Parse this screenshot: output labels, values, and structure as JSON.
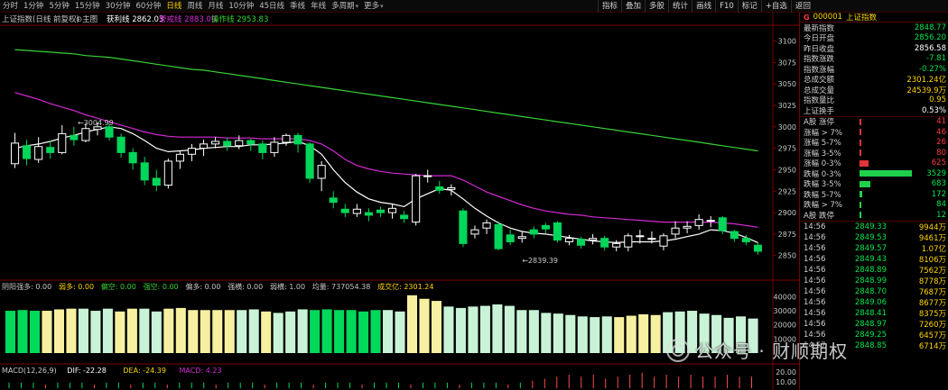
{
  "toolbar": {
    "tabs": [
      "分时",
      "1分钟",
      "5分钟",
      "15分钟",
      "30分钟",
      "60分钟",
      "日线",
      "周线",
      "月线",
      "10分钟",
      "45日线",
      "季线",
      "年线",
      "多周期",
      "更多"
    ],
    "active_tab": "日线",
    "tools": [
      "指标",
      "叠加",
      "多股",
      "统计",
      "画线",
      "F10",
      "标记",
      "+自选",
      "返回"
    ]
  },
  "main": {
    "title": "上证指数",
    "subtitle": "(日线 前复权)",
    "indicator": "主图",
    "legend": [
      {
        "label": "获利线",
        "value": "2862.03",
        "color": "#ffffff"
      },
      {
        "label": "警戒线",
        "value": "2883.09",
        "color": "#d22ad2"
      },
      {
        "label": "操作线",
        "value": "2953.83",
        "color": "#36d436"
      }
    ],
    "annotations": {
      "high": "3004.99",
      "low": "2839.39"
    },
    "axis_ticks": [
      "3100",
      "3075",
      "3050",
      "3025",
      "3000",
      "2975",
      "2950",
      "2925",
      "2900",
      "2875",
      "2850"
    ]
  },
  "volume": {
    "legend": [
      {
        "label": "阴阳",
        "value": "",
        "color": "#c8c8c8"
      },
      {
        "label": "强多",
        "value": "0.00",
        "color": "#c8c8c8"
      },
      {
        "label": "弱多",
        "value": "0.00",
        "color": "#ffd400"
      },
      {
        "label": "偏空",
        "value": "0.00",
        "color": "#36d436"
      },
      {
        "label": "强空",
        "value": "0.00",
        "color": "#36d436"
      },
      {
        "label": "偏多",
        "value": "0.00",
        "color": "#c8c8c8"
      },
      {
        "label": "强横",
        "value": "0.00",
        "color": "#c8c8c8"
      },
      {
        "label": "弱横",
        "value": "1.00",
        "color": "#c8c8c8"
      },
      {
        "label": "均量",
        "value": "737054.38",
        "color": "#c8c8c8"
      },
      {
        "label": "成交亿",
        "value": "2301.24",
        "color": "#ffd400"
      }
    ],
    "axis_ticks": [
      "40000",
      "30000",
      "20000",
      "10000"
    ]
  },
  "macd": {
    "legend": [
      {
        "label": "MACD(12,26,9)",
        "value": "",
        "color": "#c8c8c8"
      },
      {
        "label": "DIF",
        "value": "-22.28",
        "color": "#ffffff"
      },
      {
        "label": "DEA",
        "value": "-24.39",
        "color": "#ffd400"
      },
      {
        "label": "MACD",
        "value": "4.23",
        "color": "#d22ad2"
      }
    ],
    "axis_ticks": [
      "20.00",
      "10.00"
    ]
  },
  "chart_data": {
    "type": "candlestick",
    "ylim": [
      2835,
      3110
    ],
    "y_ticks": [
      3100,
      3075,
      3050,
      3025,
      3000,
      2975,
      2950,
      2925,
      2900,
      2875,
      2850
    ],
    "candles": [
      {
        "o": 2957,
        "c": 2981,
        "h": 2993,
        "l": 2952,
        "up": true
      },
      {
        "o": 2978,
        "c": 2963,
        "h": 2985,
        "l": 2955,
        "up": false
      },
      {
        "o": 2962,
        "c": 2977,
        "h": 2988,
        "l": 2958,
        "up": true
      },
      {
        "o": 2976,
        "c": 2970,
        "h": 2984,
        "l": 2963,
        "up": false
      },
      {
        "o": 2970,
        "c": 2992,
        "h": 3002,
        "l": 2968,
        "up": true
      },
      {
        "o": 2990,
        "c": 2985,
        "h": 3000,
        "l": 2978,
        "up": false
      },
      {
        "o": 2984,
        "c": 2998,
        "h": 3004,
        "l": 2982,
        "up": true
      },
      {
        "o": 2997,
        "c": 3000,
        "h": 3005,
        "l": 2990,
        "up": true
      },
      {
        "o": 3000,
        "c": 2988,
        "h": 3004,
        "l": 2984,
        "up": false
      },
      {
        "o": 2988,
        "c": 2970,
        "h": 2992,
        "l": 2964,
        "up": false
      },
      {
        "o": 2970,
        "c": 2958,
        "h": 2975,
        "l": 2950,
        "up": false
      },
      {
        "o": 2958,
        "c": 2938,
        "h": 2965,
        "l": 2932,
        "up": false
      },
      {
        "o": 2940,
        "c": 2932,
        "h": 2950,
        "l": 2925,
        "up": false
      },
      {
        "o": 2932,
        "c": 2960,
        "h": 2963,
        "l": 2928,
        "up": true
      },
      {
        "o": 2960,
        "c": 2968,
        "h": 2972,
        "l": 2951,
        "up": true
      },
      {
        "o": 2968,
        "c": 2975,
        "h": 2980,
        "l": 2960,
        "up": true
      },
      {
        "o": 2975,
        "c": 2980,
        "h": 2985,
        "l": 2966,
        "up": true
      },
      {
        "o": 2980,
        "c": 2983,
        "h": 2988,
        "l": 2975,
        "up": true
      },
      {
        "o": 2983,
        "c": 2978,
        "h": 2987,
        "l": 2972,
        "up": false
      },
      {
        "o": 2978,
        "c": 2984,
        "h": 2990,
        "l": 2974,
        "up": true
      },
      {
        "o": 2984,
        "c": 2980,
        "h": 2986,
        "l": 2972,
        "up": false
      },
      {
        "o": 2980,
        "c": 2970,
        "h": 2984,
        "l": 2962,
        "up": false
      },
      {
        "o": 2970,
        "c": 2982,
        "h": 2988,
        "l": 2965,
        "up": true
      },
      {
        "o": 2982,
        "c": 2990,
        "h": 2992,
        "l": 2978,
        "up": true
      },
      {
        "o": 2990,
        "c": 2980,
        "h": 2993,
        "l": 2970,
        "up": false
      },
      {
        "o": 2980,
        "c": 2940,
        "h": 2982,
        "l": 2935,
        "up": false
      },
      {
        "o": 2940,
        "c": 2955,
        "h": 2960,
        "l": 2925,
        "up": true
      },
      {
        "o": 2917,
        "c": 2912,
        "h": 2925,
        "l": 2905,
        "up": false
      },
      {
        "o": 2904,
        "c": 2900,
        "h": 2910,
        "l": 2895,
        "up": false
      },
      {
        "o": 2899,
        "c": 2904,
        "h": 2910,
        "l": 2895,
        "up": true
      },
      {
        "o": 2900,
        "c": 2897,
        "h": 2905,
        "l": 2890,
        "up": false
      },
      {
        "o": 2903,
        "c": 2900,
        "h": 2907,
        "l": 2895,
        "up": false
      },
      {
        "o": 2900,
        "c": 2905,
        "h": 2910,
        "l": 2893,
        "up": true
      },
      {
        "o": 2897,
        "c": 2893,
        "h": 2902,
        "l": 2888,
        "up": false
      },
      {
        "o": 2889,
        "c": 2943,
        "h": 2945,
        "l": 2885,
        "up": true
      },
      {
        "o": 2943,
        "c": 2943,
        "h": 2950,
        "l": 2935,
        "up": true
      },
      {
        "o": 2930,
        "c": 2926,
        "h": 2937,
        "l": 2922,
        "up": false
      },
      {
        "o": 2927,
        "c": 2929,
        "h": 2933,
        "l": 2920,
        "up": true
      },
      {
        "o": 2902,
        "c": 2864,
        "h": 2905,
        "l": 2860,
        "up": false
      },
      {
        "o": 2875,
        "c": 2880,
        "h": 2885,
        "l": 2870,
        "up": true
      },
      {
        "o": 2882,
        "c": 2888,
        "h": 2892,
        "l": 2875,
        "up": true
      },
      {
        "o": 2886,
        "c": 2858,
        "h": 2890,
        "l": 2856,
        "up": false
      },
      {
        "o": 2874,
        "c": 2866,
        "h": 2880,
        "l": 2862,
        "up": false
      },
      {
        "o": 2870,
        "c": 2872,
        "h": 2878,
        "l": 2865,
        "up": true
      },
      {
        "o": 2880,
        "c": 2875,
        "h": 2884,
        "l": 2870,
        "up": false
      },
      {
        "o": 2885,
        "c": 2881,
        "h": 2888,
        "l": 2876,
        "up": false
      },
      {
        "o": 2888,
        "c": 2868,
        "h": 2890,
        "l": 2865,
        "up": false
      },
      {
        "o": 2866,
        "c": 2870,
        "h": 2874,
        "l": 2862,
        "up": true
      },
      {
        "o": 2869,
        "c": 2862,
        "h": 2872,
        "l": 2858,
        "up": false
      },
      {
        "o": 2868,
        "c": 2870,
        "h": 2875,
        "l": 2863,
        "up": true
      },
      {
        "o": 2870,
        "c": 2860,
        "h": 2873,
        "l": 2856,
        "up": false
      },
      {
        "o": 2860,
        "c": 2864,
        "h": 2868,
        "l": 2855,
        "up": true
      },
      {
        "o": 2860,
        "c": 2873,
        "h": 2876,
        "l": 2855,
        "up": true
      },
      {
        "o": 2873,
        "c": 2873,
        "h": 2880,
        "l": 2864,
        "up": true
      },
      {
        "o": 2870,
        "c": 2870,
        "h": 2878,
        "l": 2864,
        "up": true
      },
      {
        "o": 2861,
        "c": 2873,
        "h": 2876,
        "l": 2856,
        "up": true
      },
      {
        "o": 2875,
        "c": 2882,
        "h": 2890,
        "l": 2870,
        "up": true
      },
      {
        "o": 2882,
        "c": 2884,
        "h": 2890,
        "l": 2876,
        "up": true
      },
      {
        "o": 2885,
        "c": 2892,
        "h": 2898,
        "l": 2880,
        "up": true
      },
      {
        "o": 2890,
        "c": 2891,
        "h": 2896,
        "l": 2883,
        "up": true
      },
      {
        "o": 2894,
        "c": 2879,
        "h": 2896,
        "l": 2875,
        "up": false
      },
      {
        "o": 2878,
        "c": 2870,
        "h": 2880,
        "l": 2866,
        "up": false
      },
      {
        "o": 2870,
        "c": 2866,
        "h": 2874,
        "l": 2862,
        "up": false
      },
      {
        "o": 2862,
        "c": 2855,
        "h": 2866,
        "l": 2851,
        "up": false
      }
    ],
    "series": [
      {
        "name": "获利线",
        "color": "#ffffff",
        "values": [
          2975,
          2978,
          2980,
          2983,
          2987,
          2990,
          2994,
          2997,
          3000,
          2998,
          2992,
          2984,
          2975,
          2971,
          2972,
          2973,
          2975,
          2976,
          2977,
          2977,
          2979,
          2979,
          2980,
          2981,
          2983,
          2978,
          2968,
          2950,
          2935,
          2924,
          2916,
          2912,
          2910,
          2907,
          2916,
          2922,
          2928,
          2926,
          2916,
          2905,
          2896,
          2888,
          2882,
          2878,
          2876,
          2875,
          2873,
          2871,
          2869,
          2867,
          2866,
          2865,
          2866,
          2866,
          2866,
          2867,
          2869,
          2872,
          2875,
          2880,
          2879,
          2876,
          2871,
          2865
        ]
      },
      {
        "name": "警戒线",
        "color": "#d22ad2",
        "values": [
          3040,
          3036,
          3032,
          3027,
          3023,
          3019,
          3014,
          3010,
          3006,
          3002,
          2998,
          2994,
          2991,
          2989,
          2988,
          2988,
          2988,
          2988,
          2987,
          2987,
          2987,
          2986,
          2986,
          2986,
          2986,
          2984,
          2980,
          2972,
          2962,
          2955,
          2951,
          2948,
          2946,
          2945,
          2944,
          2943,
          2943,
          2943,
          2938,
          2931,
          2924,
          2919,
          2914,
          2909,
          2905,
          2902,
          2900,
          2898,
          2897,
          2895,
          2894,
          2893,
          2892,
          2891,
          2890,
          2889,
          2889,
          2889,
          2889,
          2889,
          2888,
          2887,
          2885,
          2883
        ]
      },
      {
        "name": "操作线",
        "color": "#36d436",
        "values": [
          3090,
          3089,
          3088,
          3087,
          3086,
          3085,
          3083,
          3082,
          3081,
          3079,
          3077,
          3075,
          3073,
          3071,
          3069,
          3067,
          3066,
          3064,
          3062,
          3060,
          3058,
          3056,
          3054,
          3052,
          3050,
          3048,
          3046,
          3044,
          3042,
          3040,
          3038,
          3036,
          3034,
          3032,
          3030,
          3028,
          3026,
          3024,
          3022,
          3020,
          3018,
          3016,
          3014,
          3012,
          3010,
          3008,
          3006,
          3004,
          3002,
          3000,
          2998,
          2996,
          2994,
          2992,
          2990,
          2988,
          2986,
          2984,
          2982,
          2980,
          2978,
          2976,
          2974,
          2972
        ]
      }
    ],
    "volume": {
      "ylim": [
        0,
        46000
      ],
      "values": [
        30000,
        30500,
        30000,
        30000,
        31000,
        31500,
        31500,
        30000,
        31500,
        29500,
        31500,
        31500,
        29500,
        31500,
        32000,
        30500,
        30500,
        30500,
        30500,
        30500,
        31000,
        29500,
        28500,
        29500,
        31000,
        30500,
        31000,
        30500,
        30500,
        29500,
        30500,
        30500,
        29500,
        41000,
        38500,
        37000,
        33000,
        32000,
        33000,
        33500,
        34500,
        33500,
        30500,
        30500,
        28500,
        28000,
        27000,
        26000,
        25500,
        26000,
        25500,
        26500,
        27500,
        27000,
        29000,
        29500,
        30000,
        28000,
        27000,
        25000,
        26000,
        24500
      ],
      "colors": [
        "g",
        "g",
        "g",
        "y",
        "y",
        "y",
        "l",
        "l",
        "l",
        "y",
        "y",
        "l",
        "l",
        "y",
        "y",
        "y",
        "y",
        "y",
        "y",
        "l",
        "l",
        "y",
        "l",
        "l",
        "l",
        "g",
        "g",
        "g",
        "g",
        "g",
        "g",
        "l",
        "l",
        "y",
        "y",
        "y",
        "l",
        "l",
        "l",
        "l",
        "l",
        "l",
        "l",
        "l",
        "l",
        "l",
        "l",
        "l",
        "l",
        "l",
        "y",
        "y",
        "y",
        "y",
        "l",
        "l",
        "l",
        "l",
        "l",
        "l",
        "l",
        "l"
      ]
    },
    "macd": {
      "ylim": [
        -30,
        25
      ],
      "y_ticks": [
        20,
        10
      ],
      "values": [
        -1,
        -1,
        -1,
        0,
        -1,
        -1,
        -1,
        0,
        -1,
        -1,
        0,
        -1,
        -1,
        0,
        -1,
        -1,
        -1,
        0,
        -1,
        -1,
        -1,
        0,
        -1,
        -1,
        -1,
        0,
        -1,
        -1,
        -1,
        0,
        -1,
        -1,
        -1,
        0,
        -1,
        -1,
        -1,
        0,
        -1,
        -1,
        -1,
        0,
        -1,
        2,
        3,
        4,
        5,
        4,
        5,
        3,
        4,
        5,
        6,
        4,
        5,
        4,
        5,
        4,
        4,
        5,
        4,
        4
      ]
    }
  },
  "side": {
    "g_label": "G",
    "code": "000001",
    "name": "上证指数",
    "stats": [
      {
        "k": "最新指数",
        "v": "2848.77",
        "color": "#00e64c"
      },
      {
        "k": "今日开盘",
        "v": "2856.20",
        "color": "#00e64c"
      },
      {
        "k": "昨日收盘",
        "v": "2856.58",
        "color": "#ffffff"
      },
      {
        "k": "指数涨跌",
        "v": "-7.81",
        "color": "#00e64c"
      },
      {
        "k": "指数涨幅",
        "v": "-0.27%",
        "color": "#00e64c"
      },
      {
        "k": "总成交额",
        "v": "2301.24亿",
        "color": "#ffd400"
      },
      {
        "k": "总成交量",
        "v": "24539.9万",
        "color": "#ffd400"
      },
      {
        "k": "指数量比",
        "v": "0.95",
        "color": "#ffd400"
      },
      {
        "k": "上证换手",
        "v": "0.53%",
        "color": "#ffffff"
      }
    ],
    "breadth": [
      {
        "k": "A股 涨停",
        "v": "41",
        "color": "#ff3b3b",
        "bar": 0.01
      },
      {
        "k": "涨幅 > 7%",
        "v": "46",
        "color": "#ff3b3b",
        "bar": 0.01
      },
      {
        "k": "涨幅 5-7%",
        "v": "26",
        "color": "#ff3b3b",
        "bar": 0.01
      },
      {
        "k": "涨幅 3-5%",
        "v": "80",
        "color": "#ff3b3b",
        "bar": 0.02
      },
      {
        "k": "涨幅 0-3%",
        "v": "625",
        "color": "#ff3b3b",
        "bar": 0.18
      },
      {
        "k": "跌幅 0-3%",
        "v": "3529",
        "color": "#00e64c",
        "bar": 1.0
      },
      {
        "k": "跌幅 3-5%",
        "v": "683",
        "color": "#00e64c",
        "bar": 0.2
      },
      {
        "k": "跌幅 5-7%",
        "v": "172",
        "color": "#00e64c",
        "bar": 0.06
      },
      {
        "k": "跌幅 > 7%",
        "v": "84",
        "color": "#00e64c",
        "bar": 0.02
      },
      {
        "k": "A股 跌停",
        "v": "12",
        "color": "#00e64c",
        "bar": 0.01
      }
    ],
    "ticks": [
      {
        "t": "14:56",
        "p": "2849.33",
        "q": "9944万"
      },
      {
        "t": "14:56",
        "p": "2849.53",
        "q": "9461万"
      },
      {
        "t": "14:56",
        "p": "2849.57",
        "q": "1.07亿"
      },
      {
        "t": "14:56",
        "p": "2849.43",
        "q": "8106万"
      },
      {
        "t": "14:56",
        "p": "2848.89",
        "q": "7562万"
      },
      {
        "t": "14:56",
        "p": "2848.99",
        "q": "8778万"
      },
      {
        "t": "14:56",
        "p": "2848.70",
        "q": "7687万"
      },
      {
        "t": "14:56",
        "p": "2849.06",
        "q": "8677万"
      },
      {
        "t": "14:56",
        "p": "2848.41",
        "q": "8375万"
      },
      {
        "t": "14:56",
        "p": "2848.97",
        "q": "7260万"
      },
      {
        "t": "14:56",
        "p": "2849.25",
        "q": "6457万"
      },
      {
        "t": "14:57",
        "p": "2848.85",
        "q": "6714万"
      }
    ]
  },
  "watermark": {
    "text": "公众号 · 财顺期权"
  }
}
